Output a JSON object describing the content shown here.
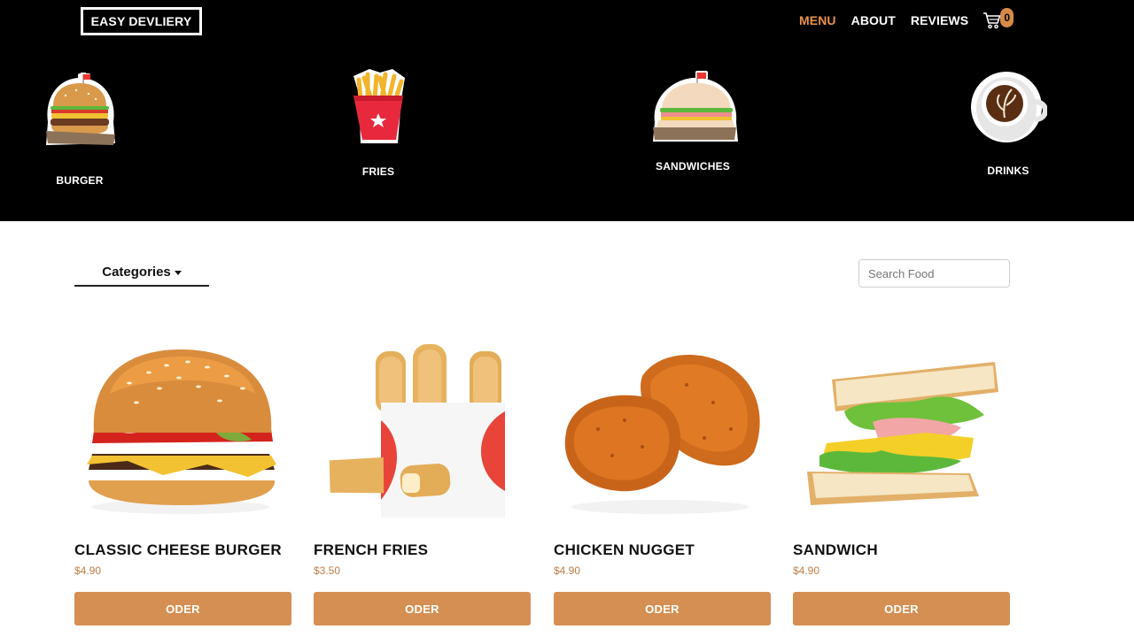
{
  "header": {
    "logo": "EASY DEVLIERY",
    "nav": [
      {
        "label": "MENU"
      },
      {
        "label": "ABOUT"
      },
      {
        "label": "REVIEWS"
      }
    ],
    "cart_count": "0",
    "accent_color": "#e8924a"
  },
  "categories": [
    {
      "label": "BURGER",
      "icon": "burger-icon"
    },
    {
      "label": "FRIES",
      "icon": "fries-icon"
    },
    {
      "label": "SANDWICHES",
      "icon": "sandwich-icon"
    },
    {
      "label": "DRINKS",
      "icon": "coffee-cup-icon"
    }
  ],
  "controls": {
    "categories_label": "Categories",
    "search_placeholder": "Search Food"
  },
  "products": [
    {
      "name": "CLASSIC CHEESE BURGER",
      "price": "$4.90",
      "button": "ODER"
    },
    {
      "name": "FRENCH FRIES",
      "price": "$3.50",
      "button": "ODER"
    },
    {
      "name": "CHICKEN NUGGET",
      "price": "$4.90",
      "button": "ODER"
    },
    {
      "name": "SANDWICH",
      "price": "$4.90",
      "button": "ODER"
    }
  ],
  "colors": {
    "header_bg": "#000000",
    "button_bg": "#d58f53",
    "price": "#c27d48"
  }
}
